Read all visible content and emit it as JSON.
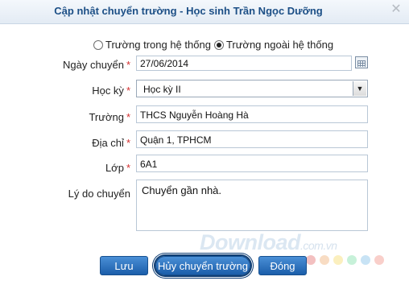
{
  "dialog": {
    "title": "Cập nhật chuyển trường - Học sinh Trần Ngọc Dưỡng",
    "close_icon": "close-icon"
  },
  "transfer_type": {
    "options": [
      {
        "label": "Trường trong hệ thống",
        "checked": false
      },
      {
        "label": "Trường ngoài hệ thống",
        "checked": true
      }
    ]
  },
  "form": {
    "date": {
      "label": "Ngày chuyển",
      "required": "*",
      "value": "27/06/2014"
    },
    "semester": {
      "label": "Học kỳ",
      "required": "*",
      "value": "Học kỳ II"
    },
    "school": {
      "label": "Trường",
      "required": "*",
      "value": "THCS Nguyễn Hoàng Hà"
    },
    "address": {
      "label": "Địa chỉ",
      "required": "*",
      "value": "Quận 1, TPHCM"
    },
    "class": {
      "label": "Lớp",
      "required": "*",
      "value": "6A1"
    },
    "reason": {
      "label": "Lý do chuyển",
      "value": "Chuyển gần nhà."
    }
  },
  "buttons": {
    "save": "Lưu",
    "cancel_transfer": "Hủy chuyển trường",
    "close": "Đóng"
  },
  "watermark": {
    "text": "Download",
    "suffix": ".com.vn"
  },
  "colors": {
    "title": "#1c4f86",
    "button": "#1b5eaa",
    "required": "#d32f2f",
    "dots": [
      "#e57373",
      "#f0b27a",
      "#f7dc6f",
      "#82e0aa",
      "#85c1e9",
      "#f1948a"
    ]
  }
}
